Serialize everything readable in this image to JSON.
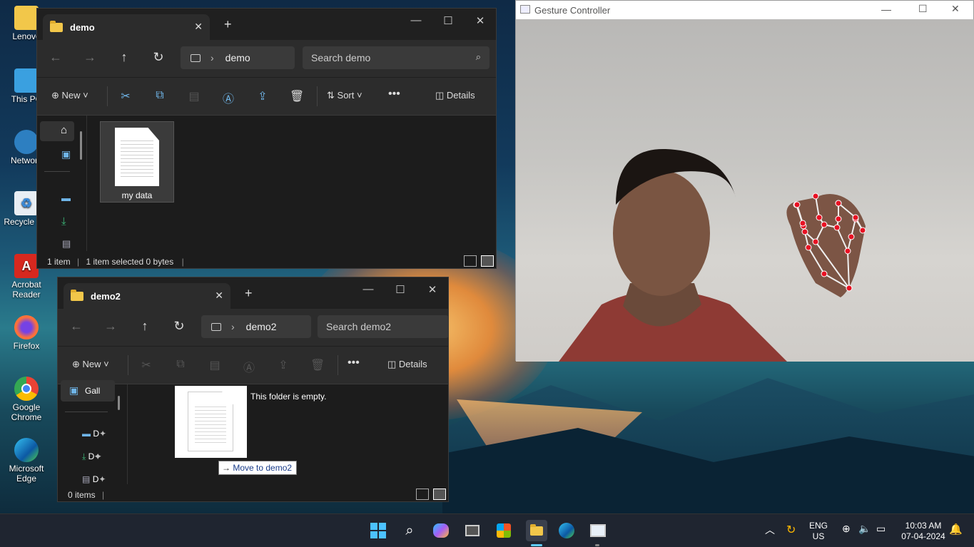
{
  "desktop": {
    "icons": [
      {
        "label": "Lenovo"
      },
      {
        "label": "This PC"
      },
      {
        "label": "Network"
      },
      {
        "label": "Recycle Bin"
      },
      {
        "label": "Acrobat Reader"
      },
      {
        "label": "Firefox"
      },
      {
        "label": "Google Chrome"
      },
      {
        "label": "Microsoft Edge"
      }
    ]
  },
  "explorer1": {
    "tab_title": "demo",
    "path": "demo",
    "search_placeholder": "Search demo",
    "new_label": "New",
    "sort_label": "Sort",
    "details_label": "Details",
    "files": [
      {
        "name": "my data"
      }
    ],
    "status_count": "1 item",
    "status_selection": "1 item selected  0 bytes"
  },
  "explorer2": {
    "tab_title": "demo2",
    "path": "demo2",
    "search_placeholder": "Search demo2",
    "new_label": "New",
    "details_label": "Details",
    "nav_gallery": "Gall",
    "nav_items": [
      "D",
      "D",
      "D"
    ],
    "empty_message": "This folder is empty.",
    "drag_tooltip": "Move to demo2",
    "status_count": "0 items"
  },
  "gesture": {
    "title": "Gesture Controller"
  },
  "taskbar": {
    "lang_top": "ENG",
    "lang_bottom": "US",
    "time": "10:03 AM",
    "date": "07-04-2024"
  },
  "colors": {
    "accent": "#60cdff",
    "landmark": "#e81123",
    "folder": "#f2c74a"
  }
}
